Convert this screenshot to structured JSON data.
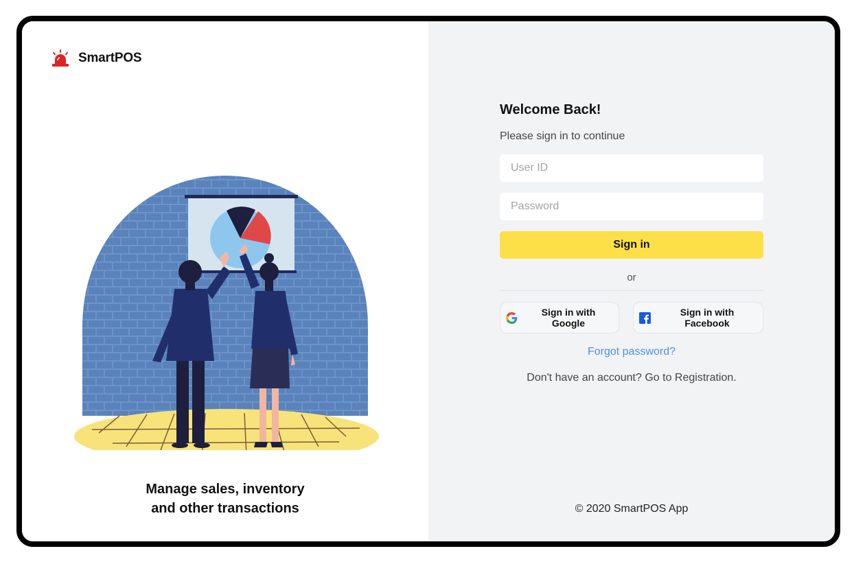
{
  "brand": {
    "name": "SmartPOS",
    "icon": "alarm-light-icon",
    "accent_color": "#e02424"
  },
  "hero": {
    "illustration": "team-presenting-pie-chart-illustration",
    "tagline_line1": "Manage sales, inventory",
    "tagline_line2": "and other transactions"
  },
  "login": {
    "title": "Welcome Back!",
    "subtitle": "Please sign in to continue",
    "user_id_placeholder": "User ID",
    "password_placeholder": "Password",
    "sign_in_label": "Sign in",
    "sign_in_color": "#fde047",
    "or_label": "or",
    "google_label": "Sign in with Google",
    "google_icon": "google-icon",
    "facebook_label": "Sign in with Facebook",
    "facebook_icon": "facebook-icon",
    "forgot_password": "Forgot password?",
    "register_prompt": "Don't have an account? Go to Registration."
  },
  "footer": {
    "copyright": "© 2020 SmartPOS App"
  }
}
